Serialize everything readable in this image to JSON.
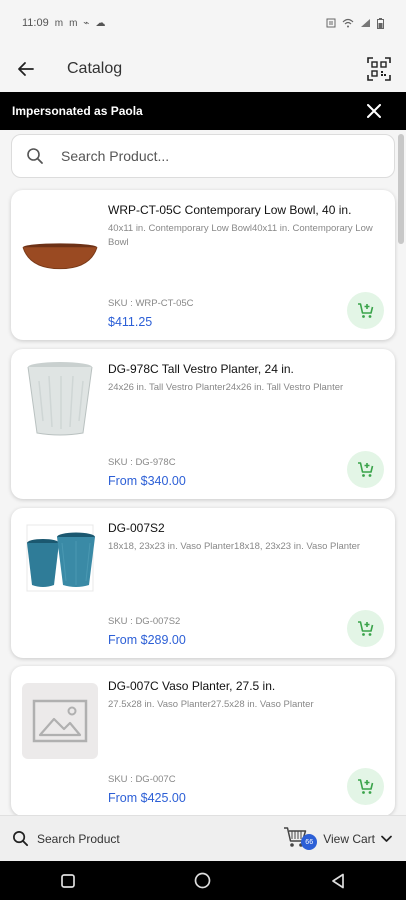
{
  "status_bar": {
    "time": "11:09",
    "left_icons": [
      "m",
      "m",
      "antenna",
      "cloud"
    ],
    "right_icons": [
      "sim",
      "wifi",
      "signal",
      "battery"
    ]
  },
  "header": {
    "title": "Catalog",
    "back_icon": "arrow-left-icon",
    "scan_icon": "qr-scan-icon"
  },
  "banner": {
    "text": "Impersonated as Paola",
    "close_icon": "close-icon"
  },
  "search": {
    "placeholder": "Search Product...",
    "value": ""
  },
  "products": [
    {
      "title": "WRP-CT-05C Contemporary Low Bowl, 40 in.",
      "description": "40x11 in. Contemporary Low Bowl40x11 in. Contemporary Low Bowl",
      "sku": "SKU : WRP-CT-05C",
      "price": "$411.25",
      "image": "terracotta-low-bowl"
    },
    {
      "title": "DG-978C Tall Vestro Planter, 24 in.",
      "description": "24x26 in. Tall Vestro Planter24x26 in. Tall Vestro Planter",
      "sku": "SKU : DG-978C",
      "price": "From $340.00",
      "image": "white-tall-planter"
    },
    {
      "title": "DG-007S2",
      "description": "18x18, 23x23 in. Vaso Planter18x18, 23x23 in. Vaso Planter",
      "sku": "SKU : DG-007S2",
      "price": "From $289.00",
      "image": "blue-vaso-planters"
    },
    {
      "title": "DG-007C Vaso Planter, 27.5 in.",
      "description": "27.5x28 in. Vaso Planter27.5x28 in. Vaso Planter",
      "sku": "SKU : DG-007C",
      "price": "From $425.00",
      "image": "image-placeholder"
    }
  ],
  "bottom_bar": {
    "search_label": "Search Product",
    "cart_label": "View Cart",
    "cart_count": "66"
  },
  "colors": {
    "accent_blue": "#2c5fd6",
    "cart_green": "#3aa34a",
    "cart_green_bg": "#e3f5e6",
    "banner_bg": "#000000"
  }
}
